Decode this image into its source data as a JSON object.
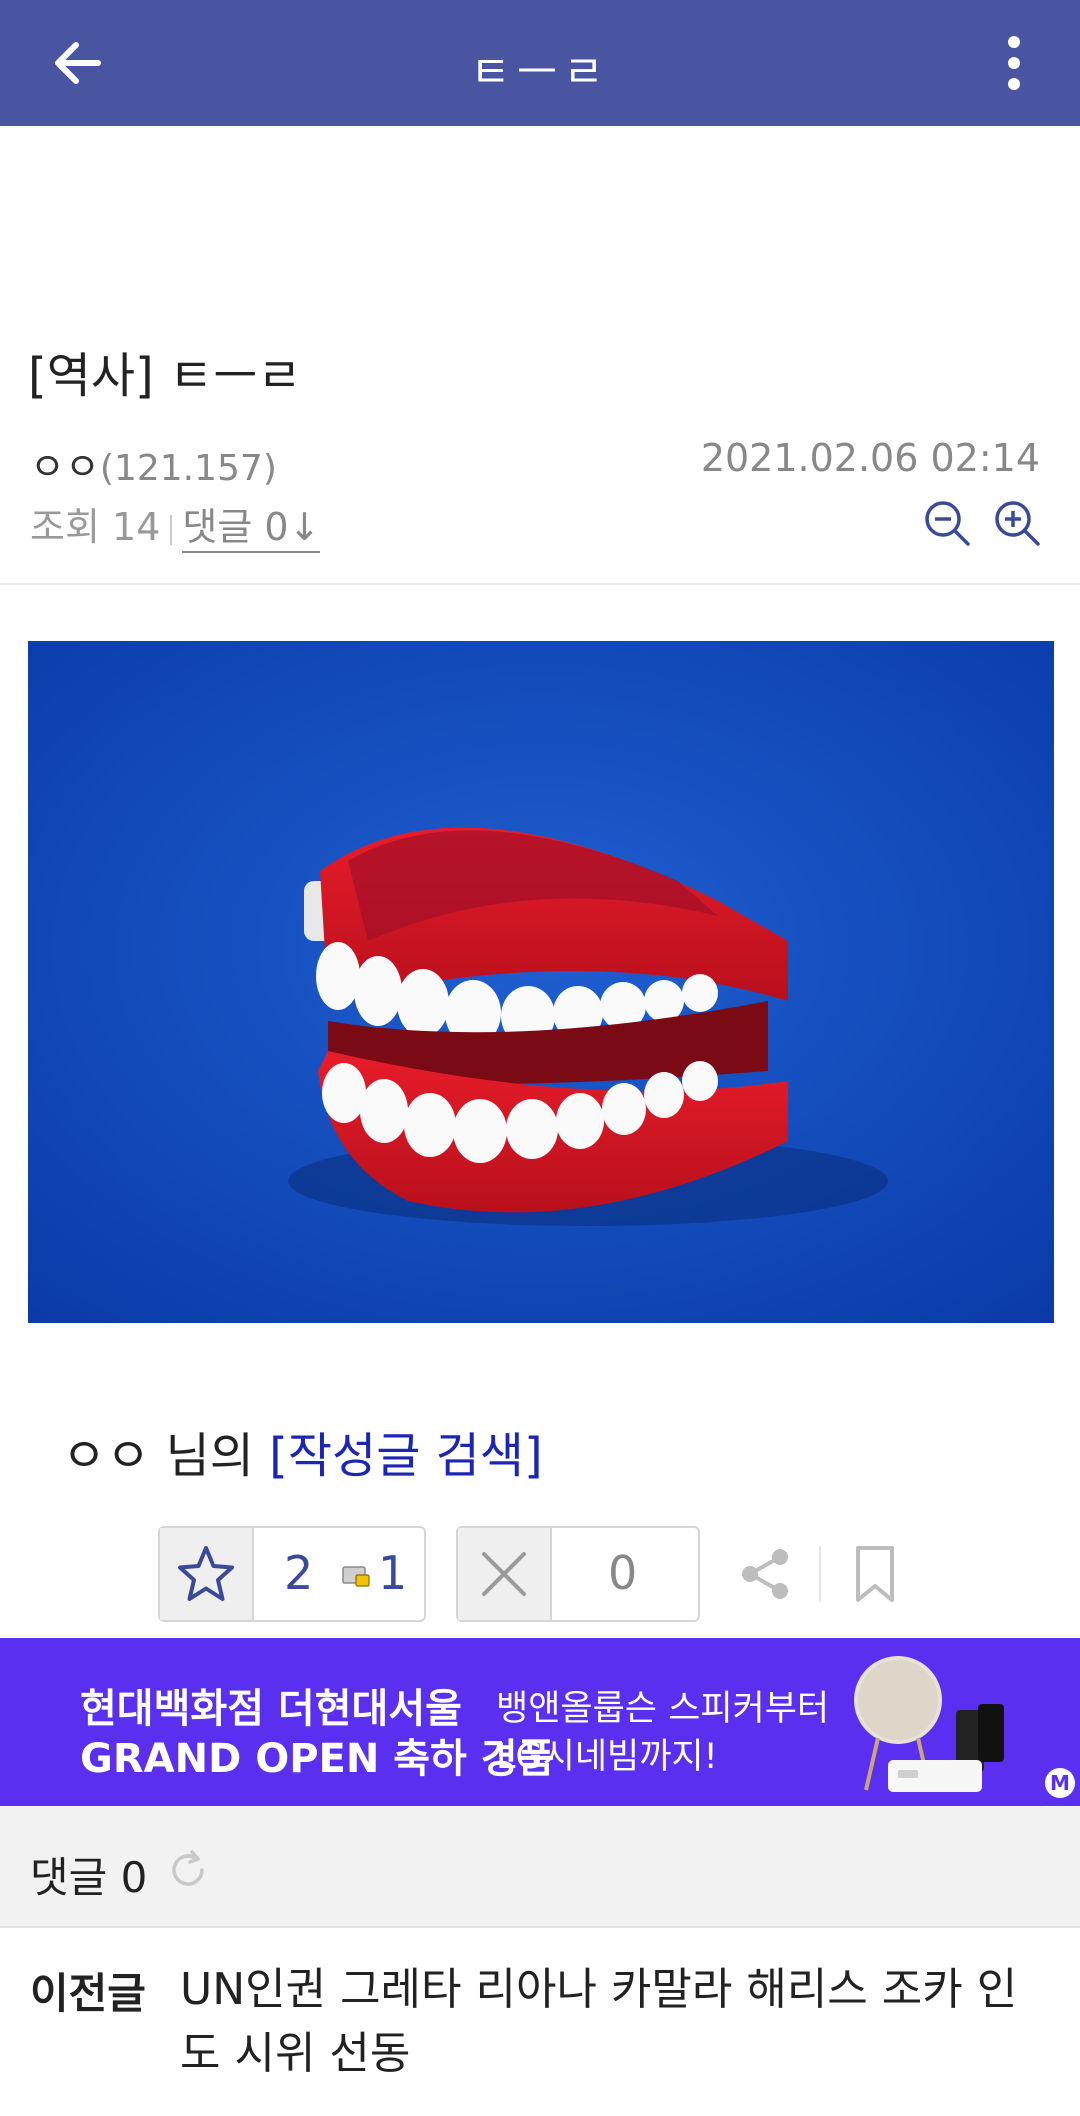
{
  "header": {
    "title": "ㅌㅡㄹ",
    "back_icon": "arrow-left-icon",
    "more_icon": "more-vertical-icon",
    "bg_color": "#4a55a2"
  },
  "post": {
    "title": "[역사] ㅌㅡㄹ",
    "author": "ㅇㅇ",
    "ip": "(121.157)",
    "datetime": "2021.02.06 02:14",
    "views_label": "조회",
    "views": "14",
    "comments_label": "댓글 0↓",
    "image_alt": "wind-up chattering teeth toy on blue background"
  },
  "author_search": {
    "name": "ㅇㅇ",
    "suffix": " 님의 ",
    "link": "[작성글 검색]"
  },
  "votes": {
    "recommend": "2",
    "fixed_recommend": "1",
    "not_recommend": "0"
  },
  "ad": {
    "line1": "현대백화점 더현대서울",
    "line2": "GRAND OPEN 축하 경품",
    "right1": "뱅앤올룹슨 스피커부터",
    "right2": "LG시네빔까지!",
    "badge": "M",
    "bg_color": "#5a2ff0"
  },
  "comments": {
    "label": "댓글 0"
  },
  "prev_post": {
    "label": "이전글",
    "text": "UN인권 그레타 리아나 카말라 해리스 조카 인도 시위 선동"
  }
}
